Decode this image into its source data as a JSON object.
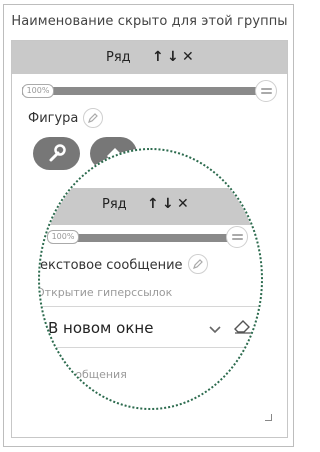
{
  "group": {
    "title": "Наименование скрыто для этой группы"
  },
  "row": {
    "label": "Ряд",
    "width_badge": "100%"
  },
  "figure": {
    "label": "Фигура"
  },
  "zoom": {
    "row_label": "Ряд",
    "width_badge": "100%",
    "text_message_label": "екстовое сообщение",
    "hyperlinks_label": "Открытие гиперссылок",
    "open_mode_value": "В новом окне",
    "message_template_label": "лон сообщения"
  },
  "icons": {
    "move_up": "arrow-up-icon",
    "move_down": "arrow-down-icon",
    "remove": "close-icon",
    "edit": "pencil-icon",
    "settings": "wrench-icon",
    "erase": "eraser-icon",
    "slider_end": "lines-icon",
    "chevron": "chevron-down-icon",
    "resize": "resize-handle-icon"
  },
  "colors": {
    "header_bg": "#c9c9c9",
    "pill_bg": "#777777",
    "magnifier_border": "#2c6b4e"
  }
}
